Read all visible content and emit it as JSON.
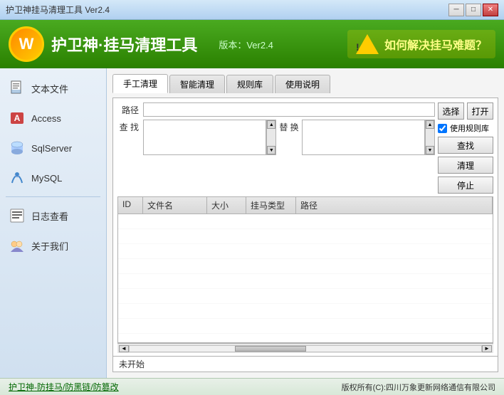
{
  "titlebar": {
    "title": "护卫神挂马清理工具 Ver2.4",
    "min_btn": "─",
    "max_btn": "□",
    "close_btn": "✕"
  },
  "header": {
    "logo_text": "W",
    "title": "护卫神·挂马清理工具",
    "version_label": "版本：Ver2.4",
    "question_text": "如何解决挂马难题？"
  },
  "sidebar": {
    "items": [
      {
        "id": "text-files",
        "label": "文本文件",
        "icon": "📄"
      },
      {
        "id": "access",
        "label": "Access",
        "icon": "🔑"
      },
      {
        "id": "sqlserver",
        "label": "SqlServer",
        "icon": "🗄"
      },
      {
        "id": "mysql",
        "label": "MySQL",
        "icon": "🐬"
      },
      {
        "id": "log-viewer",
        "label": "日志查看",
        "icon": "📋"
      },
      {
        "id": "about-us",
        "label": "关于我们",
        "icon": "👥"
      }
    ]
  },
  "tabs": [
    {
      "id": "manual-clean",
      "label": "手工清理",
      "active": true
    },
    {
      "id": "smart-clean",
      "label": "智能清理",
      "active": false
    },
    {
      "id": "rule-lib",
      "label": "规则库",
      "active": false
    },
    {
      "id": "usage-notes",
      "label": "使用说明",
      "active": false
    }
  ],
  "form": {
    "path_label": "路径",
    "search_label": "查 找",
    "replace_label": "替 换",
    "path_value": "",
    "search_value": "",
    "replace_value": "",
    "use_rulelib_label": "使用规则库",
    "use_rulelib_checked": true,
    "btn_select": "选择",
    "btn_open": "打开",
    "btn_search": "查找",
    "btn_clean": "清理",
    "btn_stop": "停止"
  },
  "table": {
    "columns": [
      "ID",
      "文件名",
      "大小",
      "挂马类型",
      "路径"
    ],
    "rows": []
  },
  "status": {
    "text": "未开始"
  },
  "bottombar": {
    "link": "护卫神-防挂马/防黑链/防篡改",
    "copyright": "版权所有(C):四川万象更新网络通信有限公司"
  }
}
